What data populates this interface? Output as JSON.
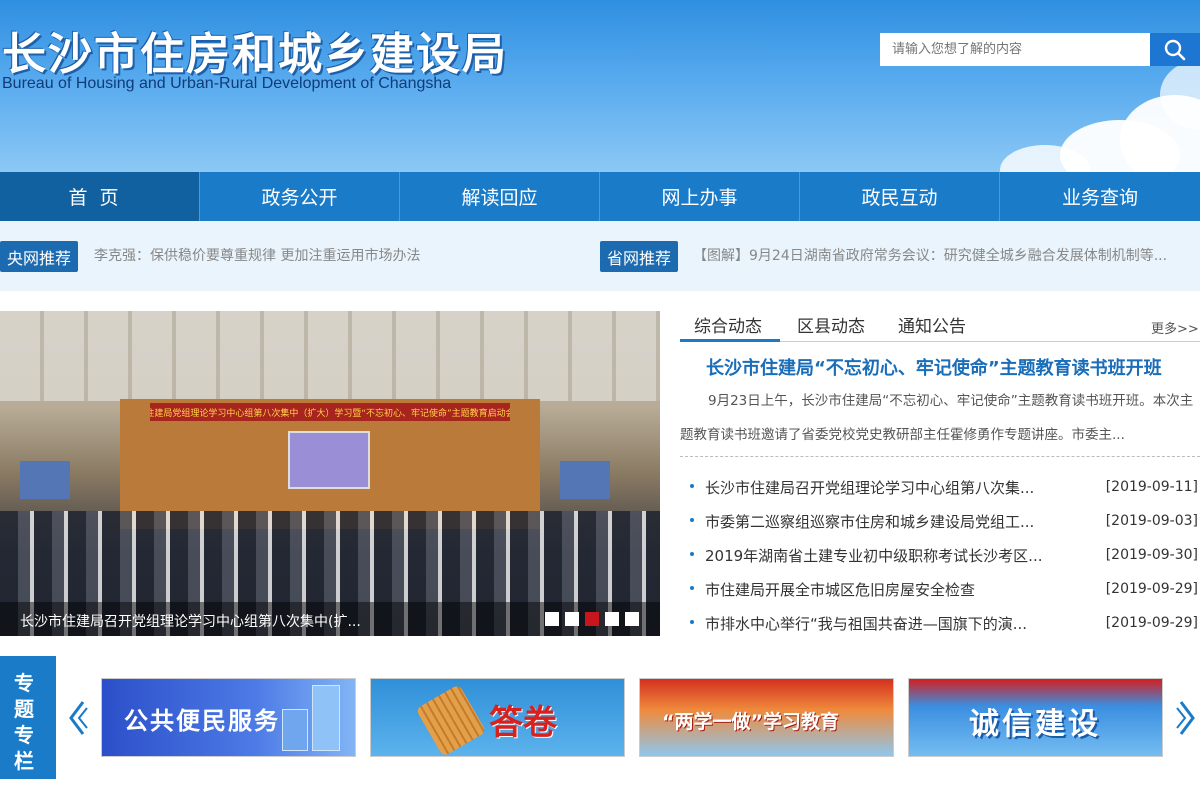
{
  "header": {
    "title": "长沙市住房和城乡建设局",
    "subtitle": "Bureau of Housing and Urban-Rural Development of Changsha",
    "search_placeholder": "请输入您想了解的内容"
  },
  "nav": {
    "items": [
      "首页",
      "政务公开",
      "解读回应",
      "网上办事",
      "政民互动",
      "业务查询"
    ]
  },
  "recommend": {
    "central_tag": "央网推荐",
    "central_text": "李克强：保供稳价要尊重规律 更加注重运用市场办法",
    "province_tag": "省网推荐",
    "province_text": "【图解】9月24日湖南省政府常务会议：研究健全城乡融合发展体制机制等..."
  },
  "slideshow": {
    "banner_text": "市住建局党组理论学习中心组第八次集中（扩大）学习暨“不忘初心、牢记使命”主题教育启动会议",
    "caption": "长沙市住建局召开党组理论学习中心组第八次集中(扩...",
    "dot_count": 5,
    "active_index": 2
  },
  "news": {
    "tabs": [
      "综合动态",
      "区县动态",
      "通知公告"
    ],
    "more": "更多>>",
    "headline": "长沙市住建局“不忘初心、牢记使命”主题教育读书班开班",
    "summary": "9月23日上午，长沙市住建局“不忘初心、牢记使命”主题教育读书班开班。本次主题教育读书班邀请了省委党校党史教研部主任霍修勇作专题讲座。市委主...",
    "items": [
      {
        "title": "长沙市住建局召开党组理论学习中心组第八次集...",
        "date": "[2019-09-11]"
      },
      {
        "title": "市委第二巡察组巡察市住房和城乡建设局党组工...",
        "date": "[2019-09-03]"
      },
      {
        "title": "2019年湖南省土建专业初中级职称考试长沙考区...",
        "date": "[2019-09-30]"
      },
      {
        "title": "市住建局开展全市城区危旧房屋安全检查",
        "date": "[2019-09-29]"
      },
      {
        "title": "市排水中心举行“我与祖国共奋进—国旗下的演...",
        "date": "[2019-09-29]"
      }
    ]
  },
  "special": {
    "label": "专题专栏",
    "banners": [
      "公共便民服务",
      "答卷",
      "“两学一做”学习教育",
      "诚信建设"
    ]
  }
}
